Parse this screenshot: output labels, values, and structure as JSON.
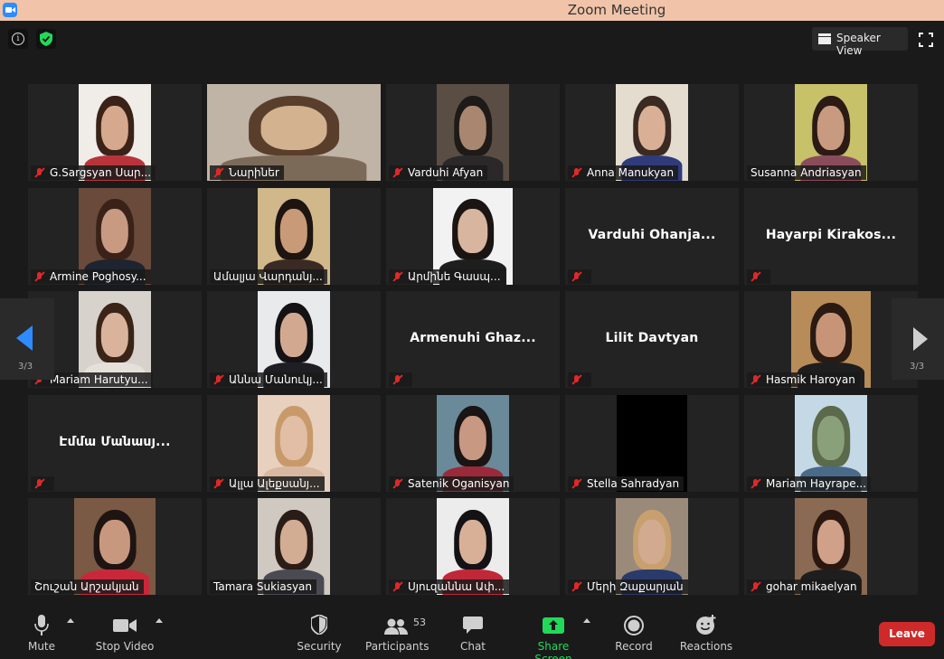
{
  "window": {
    "title": "Zoom Meeting"
  },
  "top": {
    "speaker_view_label": "Speaker View"
  },
  "grid": {
    "tiles": [
      {
        "name": "G.Sargsyan Սար...",
        "muted": true,
        "has_video": true,
        "bg": "#f0ede8",
        "hair": "#3a2218",
        "skin": "#d6a98e",
        "body_color": "#b8343a",
        "video_width": 80
      },
      {
        "name": "Նարինեr",
        "muted": true,
        "has_video": true,
        "bg": "#bfb4a6",
        "hair": "#5a3e2c",
        "skin": "#d2b28f",
        "body_color": "#7c6a58",
        "video_width": 192
      },
      {
        "name": "Varduhi Afyan",
        "muted": true,
        "has_video": true,
        "bg": "#5a4e44",
        "hair": "#1e1a18",
        "skin": "#a88670",
        "body_color": "#2a2828",
        "video_width": 80
      },
      {
        "name": "Anna Manukyan",
        "muted": true,
        "has_video": true,
        "bg": "#e4dccf",
        "hair": "#3a2a22",
        "skin": "#d9b096",
        "body_color": "#2f3b7a",
        "video_width": 80
      },
      {
        "name": "Susanna Andriasyan",
        "muted": false,
        "has_video": true,
        "bg": "#c7c16a",
        "hair": "#2c1a14",
        "skin": "#c89b80",
        "body_color": "#8a4c5a",
        "video_width": 80
      },
      {
        "name": "Armine Poghosy...",
        "muted": true,
        "has_video": true,
        "bg": "#6a4a3a",
        "hair": "#3a2218",
        "skin": "#c89a82",
        "body_color": "#1e2430",
        "video_width": 80
      },
      {
        "name": "Ամալյա Վարդանյ...",
        "muted": false,
        "has_video": true,
        "bg": "#d0b88a",
        "hair": "#1e1410",
        "skin": "#c99a78",
        "body_color": "#3a2a24",
        "video_width": 80
      },
      {
        "name": "Արմինե Գասպ...",
        "muted": true,
        "has_video": true,
        "bg": "#f2f2f2",
        "hair": "#1a1412",
        "skin": "#d8b59e",
        "body_color": "#1e1e1e",
        "video_width": 88
      },
      {
        "name": "Varduhi Ohanja...",
        "muted": true,
        "has_video": false
      },
      {
        "name": "Hayarpi Kirakos...",
        "muted": true,
        "has_video": false
      },
      {
        "name": "Mariam Harutyu...",
        "muted": true,
        "has_video": true,
        "bg": "#d8d2cc",
        "hair": "#3a2418",
        "skin": "#d9b39c",
        "body_color": "#e6e0da",
        "video_width": 80
      },
      {
        "name": "Աննա Մանուկյ...",
        "muted": true,
        "has_video": true,
        "bg": "#e8eaec",
        "hair": "#141214",
        "skin": "#d2a990",
        "body_color": "#1e1e24",
        "video_width": 80
      },
      {
        "name": "Armenuhi Ghaz...",
        "muted": true,
        "has_video": false
      },
      {
        "name": "Lilit Davtyan",
        "muted": true,
        "has_video": false
      },
      {
        "name": "Hasmik Haroyan",
        "muted": true,
        "has_video": true,
        "bg": "#b88c58",
        "hair": "#2a1a12",
        "skin": "#c89478",
        "body_color": "#1e1e1e",
        "video_width": 88
      },
      {
        "name": "Էմմա Մանասյ...",
        "muted": true,
        "has_video": false
      },
      {
        "name": "Ալլա Ալեքսանյ...",
        "muted": true,
        "has_video": true,
        "bg": "#e8d0be",
        "hair": "#c89a6a",
        "skin": "#e2bea6",
        "body_color": "#d8b8a0",
        "video_width": 80
      },
      {
        "name": "Satenik Oganisyan",
        "muted": true,
        "has_video": true,
        "bg": "#6a8a9a",
        "hair": "#1a1414",
        "skin": "#c89882",
        "body_color": "#9a2a3a",
        "video_width": 80
      },
      {
        "name": "Stella Sahradyan",
        "muted": true,
        "has_video": true,
        "bg": "#000000",
        "hair": "#000000",
        "skin": "#000000",
        "body_color": "#000000",
        "video_width": 78
      },
      {
        "name": "Mariam Hayrape...",
        "muted": true,
        "has_video": true,
        "bg": "#c4d8e6",
        "hair": "#5a6a4a",
        "skin": "#8aa07a",
        "body_color": "#4a6a8a",
        "video_width": 80
      },
      {
        "name": "Շուշան Արշակյան",
        "muted": false,
        "has_video": true,
        "bg": "#7a5a44",
        "hair": "#1e1412",
        "skin": "#c8987e",
        "body_color": "#c8283a",
        "video_width": 90
      },
      {
        "name": "Tamara Sukiasyan",
        "muted": false,
        "has_video": true,
        "bg": "#cfc9c2",
        "hair": "#2a1c16",
        "skin": "#d2ad94",
        "body_color": "#4a4a52",
        "video_width": 80
      },
      {
        "name": "Սյուզաննա Ափ...",
        "muted": true,
        "has_video": true,
        "bg": "#ececec",
        "hair": "#141214",
        "skin": "#d8b098",
        "body_color": "#c02838",
        "video_width": 80
      },
      {
        "name": "Մերի Զաքարյան",
        "muted": true,
        "has_video": true,
        "bg": "#9a8a7a",
        "hair": "#c8a070",
        "skin": "#d2aa90",
        "body_color": "#2a3a6a",
        "video_width": 80
      },
      {
        "name": "gohar mikaelyan",
        "muted": true,
        "has_video": true,
        "bg": "#8a6a52",
        "hair": "#2a1810",
        "skin": "#d0a088",
        "body_color": "#1e1e1e",
        "video_width": 80
      }
    ]
  },
  "pagination": {
    "left_page": "3/3",
    "right_page": "3/3"
  },
  "toolbar": {
    "mute_label": "Mute",
    "stop_video_label": "Stop Video",
    "security_label": "Security",
    "participants_label": "Participants",
    "participants_count": "53",
    "chat_label": "Chat",
    "share_screen_label": "Share Screen",
    "record_label": "Record",
    "reactions_label": "Reactions",
    "leave_label": "Leave"
  },
  "colors": {
    "accent": "#2d8cff",
    "share_green": "#23d959",
    "leave_red": "#cf2a2a",
    "muted_red": "#e02828"
  }
}
